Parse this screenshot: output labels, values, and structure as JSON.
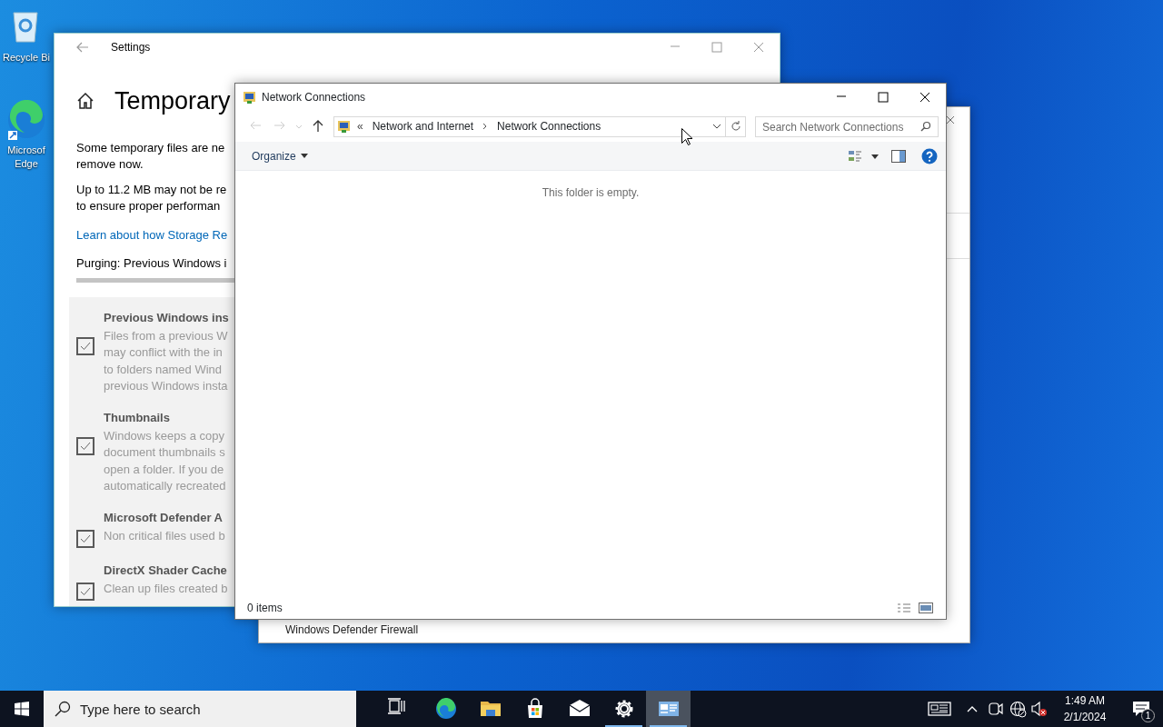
{
  "desktop_icons": [
    {
      "kind": "recycle",
      "lines": [
        "Recycle Bi"
      ]
    },
    {
      "kind": "edge",
      "lines": [
        "Microsof",
        "Edge"
      ]
    }
  ],
  "settings_window": {
    "title": "Settings",
    "heading": "Temporary",
    "paragraphs": [
      [
        "Some temporary files are ne",
        "remove now."
      ],
      [
        "Up to 11.2 MB may not be re",
        "to ensure proper performan"
      ]
    ],
    "link": "Learn about how Storage Re",
    "status": "Purging: Previous Windows i",
    "progress": {
      "level": 1
    },
    "items": [
      {
        "title": "Previous Windows ins",
        "lines": [
          "Files from a previous W",
          "may conflict with the in",
          "to folders named Wind",
          "previous Windows insta"
        ],
        "checked": true
      },
      {
        "title": "Thumbnails",
        "lines": [
          "Windows keeps a copy",
          "document thumbnails s",
          "open a folder. If you de",
          "automatically recreated"
        ],
        "checked": true
      },
      {
        "title": "Microsoft Defender A",
        "lines": [
          "Non critical files used b"
        ],
        "checked": true
      },
      {
        "title": "DirectX Shader Cache",
        "lines": [
          "Clean up files created b"
        ],
        "checked": true
      }
    ]
  },
  "back_window": {
    "text": "Windows Defender Firewall"
  },
  "explorer": {
    "title": "Network Connections",
    "overflow": "«",
    "breadcrumb": [
      "Network and Internet",
      "Network Connections"
    ],
    "search": {
      "placeholder": "Search Network Connections"
    },
    "organize": "Organize",
    "empty_text": "This folder is empty.",
    "status": "0 items"
  },
  "taskbar": {
    "search": {
      "placeholder": "Type here to search"
    },
    "apps": [
      {
        "kind": "taskview",
        "running": false,
        "selected": false
      },
      {
        "kind": "edge",
        "running": false,
        "selected": false
      },
      {
        "kind": "folder",
        "running": false,
        "selected": false
      },
      {
        "kind": "store",
        "running": false,
        "selected": false
      },
      {
        "kind": "mail",
        "running": false,
        "selected": false
      },
      {
        "kind": "settings",
        "running": true,
        "selected": false
      },
      {
        "kind": "network",
        "running": true,
        "selected": true
      }
    ],
    "time": "1:49 AM",
    "date": "2/1/2024",
    "notifications": "1"
  }
}
